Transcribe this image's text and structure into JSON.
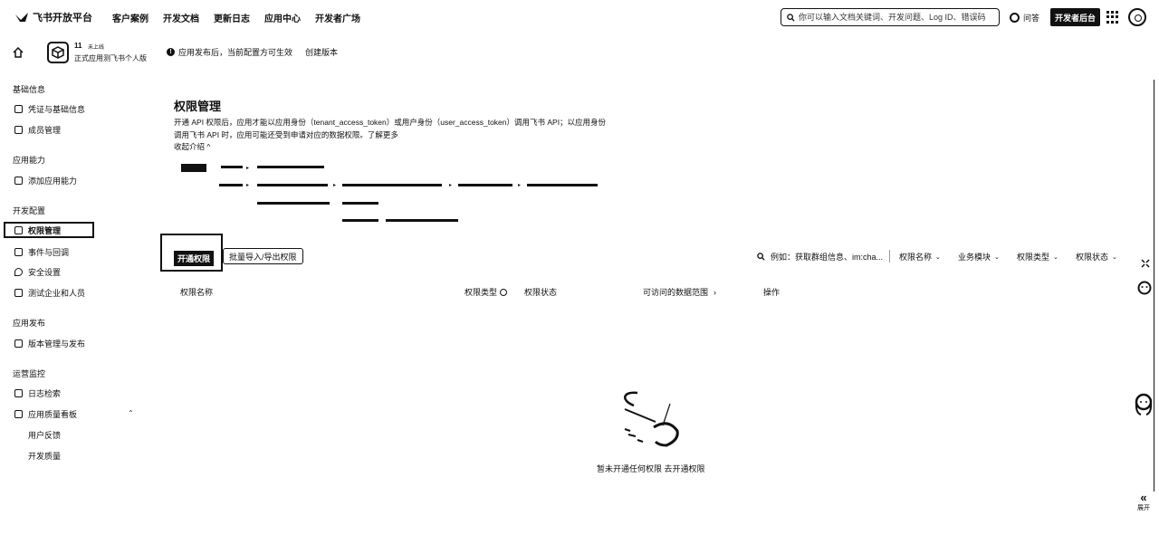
{
  "topbar": {
    "logo_text": "飞书开放平台",
    "nav": [
      "客户案例",
      "开发文档",
      "更新日志",
      "应用中心",
      "开发者广场"
    ],
    "search_placeholder": "你可以输入文档关键词、开发问题、Log ID、错误码",
    "ask_label": "问答",
    "console_label": "开发者后台"
  },
  "appbar": {
    "app_name": "11",
    "app_status": "未上线",
    "app_subtitle": "正式应用测飞书个人版",
    "notice": "应用发布后，当前配置方可生效",
    "create_version": "创建版本"
  },
  "sidebar": {
    "sections": [
      {
        "title": "基础信息",
        "items": [
          {
            "label": "凭证与基础信息",
            "icon": "id-card-icon"
          },
          {
            "label": "成员管理",
            "icon": "member-icon"
          }
        ]
      },
      {
        "title": "应用能力",
        "items": [
          {
            "label": "添加应用能力",
            "icon": "grid-plus-icon"
          }
        ]
      },
      {
        "title": "开发配置",
        "items": [
          {
            "label": "权限管理",
            "icon": "lock-icon"
          },
          {
            "label": "事件与回调",
            "icon": "event-icon"
          },
          {
            "label": "安全设置",
            "icon": "shield-icon"
          },
          {
            "label": "测试企业和人员",
            "icon": "test-icon"
          }
        ]
      },
      {
        "title": "应用发布",
        "items": [
          {
            "label": "版本管理与发布",
            "icon": "version-icon"
          }
        ]
      },
      {
        "title": "运营监控",
        "items": [
          {
            "label": "日志检索",
            "icon": "log-icon"
          },
          {
            "label": "应用质量看板",
            "icon": "chart-icon"
          }
        ]
      }
    ],
    "sub_items": [
      "用户反馈",
      "开发质量"
    ]
  },
  "content": {
    "title": "权限管理",
    "desc": "开通 API 权限后，应用才能以应用身份（tenant_access_token）或用户身份（user_access_token）调用飞书 API；以应用身份调用飞书 API 时，应用可能还受到申请对应的数据权限。了解更多",
    "collapse": "收起介绍"
  },
  "toolbar": {
    "open_label": "开通权限",
    "batch_label": "批量导入/导出权限",
    "search_placeholder": "例如：获取群组信息、im:cha...",
    "filters": [
      "权限名称",
      "业务模块",
      "权限类型",
      "权限状态"
    ]
  },
  "table": {
    "columns": [
      "权限名称",
      "权限类型",
      "权限状态",
      "可访问的数据范围",
      "操作"
    ]
  },
  "empty": {
    "text": "暂未开通任何权限",
    "link": "去开通权限"
  },
  "floating": {
    "expand_label": "展开"
  }
}
